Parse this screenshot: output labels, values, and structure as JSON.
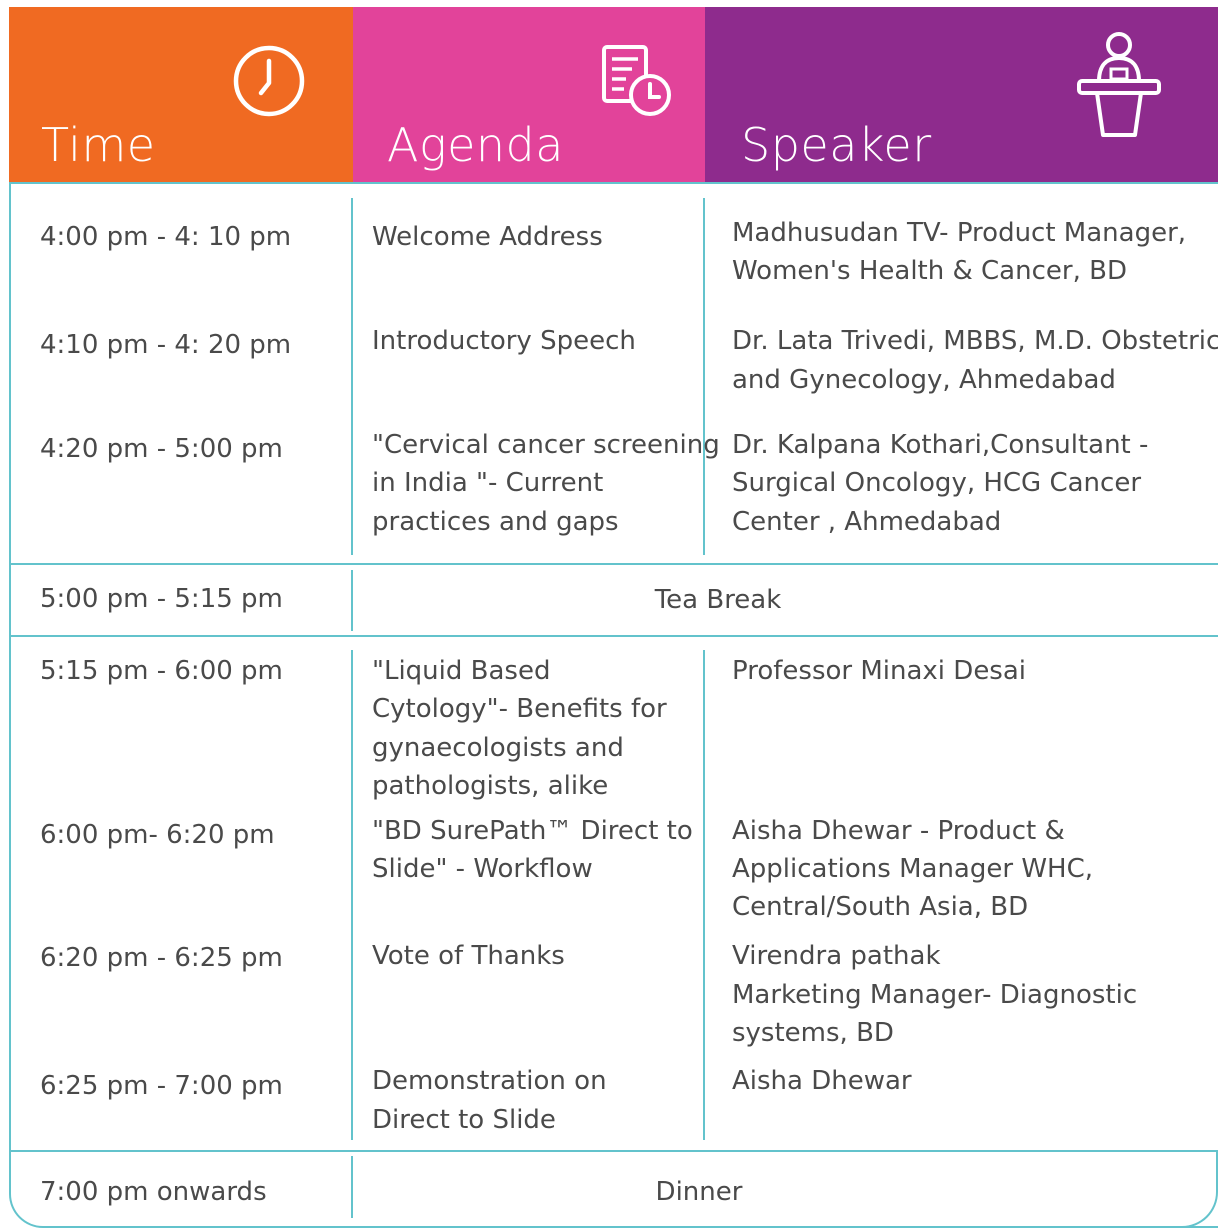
{
  "header": {
    "time_label": "Time",
    "agenda_label": "Agenda",
    "speaker_label": "Speaker",
    "time_icon": "clock-icon",
    "agenda_icon": "schedule-icon",
    "speaker_icon": "podium-speaker-icon",
    "colors": {
      "time": "#f06a22",
      "agenda": "#e2439a",
      "speaker": "#8e2b8d",
      "rule": "#63c3cc"
    }
  },
  "rows": [
    {
      "time": "4:00 pm - 4: 10 pm",
      "agenda": "Welcome Address",
      "speaker": [
        "Madhusudan TV- Product Manager,",
        "Women's Health & Cancer, BD"
      ]
    },
    {
      "time": "4:10 pm - 4: 20 pm",
      "agenda": "Introductory Speech",
      "speaker": [
        "Dr. Lata Trivedi, MBBS, M.D. Obstetrics",
        "and Gynecology, Ahmedabad"
      ]
    },
    {
      "time": "4:20 pm - 5:00 pm",
      "agenda": [
        "\"Cervical cancer screening",
        "in India \"- Current",
        "practices and gaps"
      ],
      "speaker": [
        "Dr. Kalpana Kothari,Consultant -",
        "Surgical Oncology, HCG Cancer",
        "Center , Ahmedabad"
      ]
    },
    {
      "time": "5:00 pm - 5:15 pm",
      "break": "Tea Break"
    },
    {
      "time": "5:15 pm - 6:00 pm",
      "agenda": [
        "\"Liquid Based",
        "Cytology\"- Benefits for",
        "gynaecologists and",
        "pathologists, alike"
      ],
      "speaker": "Professor Minaxi Desai"
    },
    {
      "time": "6:00 pm- 6:20 pm",
      "agenda": [
        "\"BD SurePath™ Direct to",
        "Slide\" - Workflow"
      ],
      "speaker": [
        "Aisha Dhewar - Product &",
        "Applications Manager WHC,",
        "Central/South Asia, BD"
      ]
    },
    {
      "time": "6:20 pm - 6:25 pm",
      "agenda": "Vote of Thanks",
      "speaker": [
        "Virendra pathak",
        "Marketing Manager- Diagnostic",
        "systems, BD"
      ]
    },
    {
      "time": "6:25 pm - 7:00 pm",
      "agenda": [
        "Demonstration on",
        "Direct to Slide"
      ],
      "speaker": "Aisha Dhewar"
    },
    {
      "time": "7:00 pm onwards",
      "break": "Dinner"
    }
  ]
}
